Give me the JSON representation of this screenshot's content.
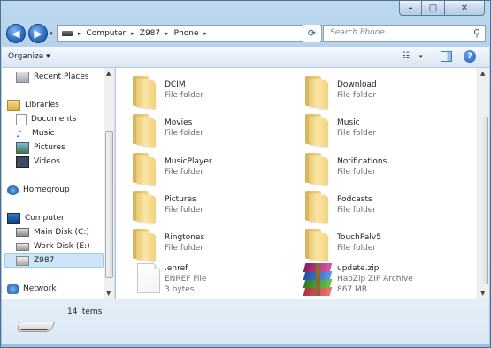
{
  "window": {
    "caption": {
      "minimize": "–",
      "maximize": "□",
      "close": "✕"
    }
  },
  "nav": {
    "back": "◀",
    "forward": "▶",
    "history_drop": "▾"
  },
  "address": {
    "crumbs": [
      "Computer",
      "Z987",
      "Phone"
    ],
    "separator": "▸",
    "dropdown": "▾",
    "refresh": "⟳"
  },
  "search": {
    "placeholder": "Search Phone",
    "icon": "⚲"
  },
  "toolbar": {
    "organize_label": "Organize ▾",
    "view_icon": "☷",
    "view_drop": "▾",
    "help": "?"
  },
  "sidebar": {
    "items": [
      {
        "label": "Recent Places",
        "icon": "recent-places-icon",
        "indent": 1
      },
      {
        "label": "Libraries",
        "icon": "libraries-icon",
        "indent": 0
      },
      {
        "label": "Documents",
        "icon": "documents-icon",
        "indent": 1
      },
      {
        "label": "Music",
        "icon": "music-icon",
        "indent": 1
      },
      {
        "label": "Pictures",
        "icon": "pictures-icon",
        "indent": 1
      },
      {
        "label": "Videos",
        "icon": "videos-icon",
        "indent": 1
      },
      {
        "label": "Homegroup",
        "icon": "homegroup-icon",
        "indent": 0
      },
      {
        "label": "Computer",
        "icon": "computer-icon",
        "indent": 0
      },
      {
        "label": "Main Disk (C:)",
        "icon": "drive-icon",
        "indent": 1
      },
      {
        "label": "Work Disk (E:)",
        "icon": "drive-icon",
        "indent": 1
      },
      {
        "label": "Z987",
        "icon": "device-icon",
        "indent": 1,
        "selected": true
      },
      {
        "label": "Network",
        "icon": "network-icon",
        "indent": 0
      }
    ]
  },
  "files": [
    {
      "name": "DCIM",
      "type": "File folder",
      "kind": "folder"
    },
    {
      "name": "Download",
      "type": "File folder",
      "kind": "folder"
    },
    {
      "name": "Movies",
      "type": "File folder",
      "kind": "folder"
    },
    {
      "name": "Music",
      "type": "File folder",
      "kind": "folder"
    },
    {
      "name": "MusicPlayer",
      "type": "File folder",
      "kind": "folder"
    },
    {
      "name": "Notifications",
      "type": "File folder",
      "kind": "folder"
    },
    {
      "name": "Pictures",
      "type": "File folder",
      "kind": "folder"
    },
    {
      "name": "Podcasts",
      "type": "File folder",
      "kind": "folder"
    },
    {
      "name": "Ringtones",
      "type": "File folder",
      "kind": "folder"
    },
    {
      "name": "TouchPalv5",
      "type": "File folder",
      "kind": "folder"
    },
    {
      "name": ".enref",
      "type": "ENREF File",
      "size": "3 bytes",
      "kind": "file"
    },
    {
      "name": "update.zip",
      "type": "HaoZip ZIP Archive",
      "size": "867 MB",
      "kind": "zip"
    }
  ],
  "details": {
    "item_count": "14 items"
  },
  "colors": {
    "window_frame": "#aecbe8",
    "selection": "#cce6f7",
    "folder": "#f2d27c"
  }
}
